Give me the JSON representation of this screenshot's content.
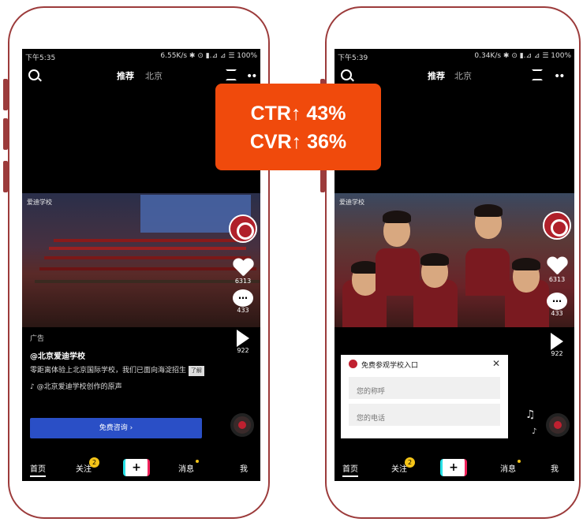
{
  "left_phone": {
    "status_time": "下午5:35",
    "status_right": "6.55K/s ✱ ⊙ ▮.⊿ ⊿ ☰ 100%",
    "tab_recommend": "推荐",
    "tab_city": "北京",
    "school_logo": "爱迪学校",
    "like_count": "6313",
    "comment_count": "433",
    "share_count": "922",
    "ad_tag": "广告",
    "account": "@北京爱迪学校",
    "description": "零距离体验上北京国际学校，我们已面向海淀招生",
    "tag_chip": "了解",
    "music": "@北京爱迪学校创作的原声",
    "cta": "免费咨询 ›"
  },
  "right_phone": {
    "status_time": "下午5:39",
    "status_right": "0.34K/s ✱ ⊙ ▮.⊿ ⊿ ☰ 100%",
    "tab_recommend": "推荐",
    "tab_city": "北京",
    "school_logo": "爱迪学校",
    "like_count": "6313",
    "comment_count": "433",
    "share_count": "922",
    "form_title": "免费参观学校入口",
    "name_placeholder": "您的称呼",
    "phone_placeholder": "您的电话"
  },
  "nav": {
    "home": "首页",
    "follow": "关注",
    "follow_badge": "2",
    "plus": "+",
    "messages": "消息",
    "me": "我"
  },
  "metrics": {
    "ctr": "CTR↑ 43%",
    "cvr": "CVR↑ 36%"
  },
  "colors": {
    "accent": "#f04a0c",
    "cta_blue": "#2a4fc6",
    "frame": "#9c3b3b"
  }
}
